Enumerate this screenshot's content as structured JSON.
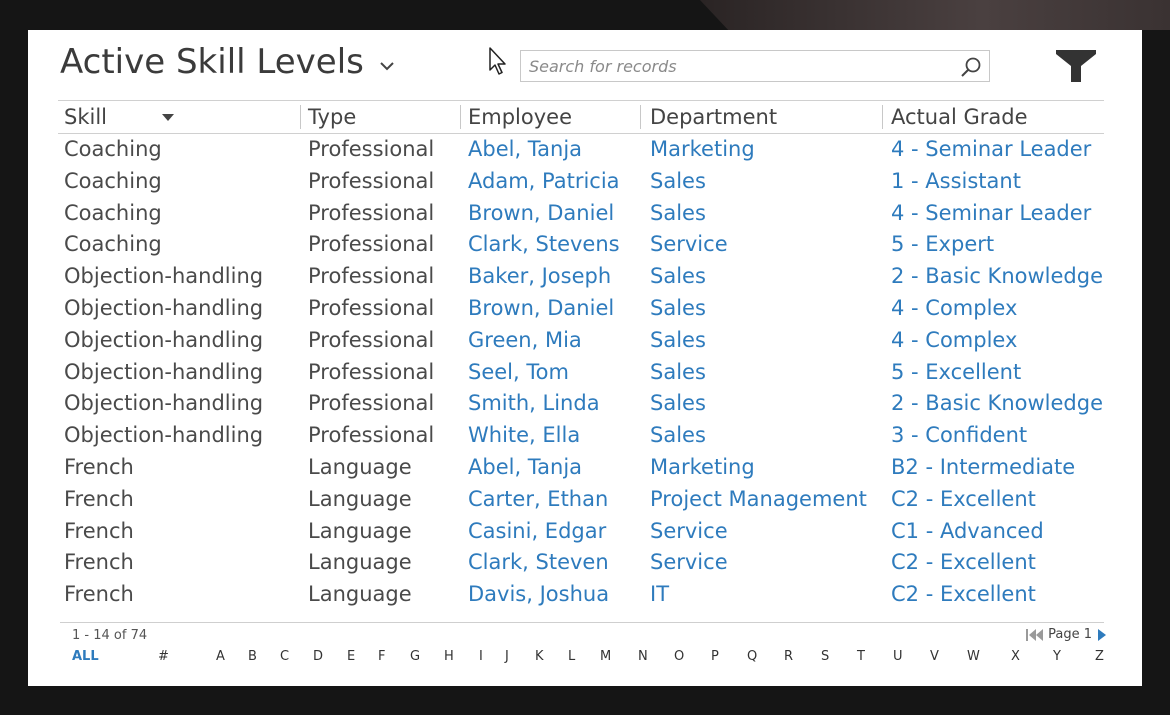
{
  "header": {
    "title": "Active Skill Levels",
    "search_placeholder": "Search for records"
  },
  "columns": [
    "Skill",
    "Type",
    "Employee",
    "Department",
    "Actual Grade"
  ],
  "rows": [
    [
      "Coaching",
      "Professional",
      "Abel, Tanja",
      "Marketing",
      "4 - Seminar Leader"
    ],
    [
      "Coaching",
      "Professional",
      "Adam, Patricia",
      "Sales",
      "1 - Assistant"
    ],
    [
      "Coaching",
      "Professional",
      "Brown, Daniel",
      "Sales",
      "4 - Seminar Leader"
    ],
    [
      "Coaching",
      "Professional",
      "Clark, Stevens",
      "Service",
      "5 - Expert"
    ],
    [
      "Objection-handling",
      "Professional",
      "Baker, Joseph",
      "Sales",
      "2 - Basic Knowledge"
    ],
    [
      "Objection-handling",
      "Professional",
      "Brown, Daniel",
      "Sales",
      "4 - Complex"
    ],
    [
      "Objection-handling",
      "Professional",
      "Green, Mia",
      "Sales",
      "4 - Complex"
    ],
    [
      "Objection-handling",
      "Professional",
      "Seel, Tom",
      "Sales",
      "5 - Excellent"
    ],
    [
      "Objection-handling",
      "Professional",
      "Smith, Linda",
      "Sales",
      "2 - Basic Knowledge"
    ],
    [
      "Objection-handling",
      "Professional",
      "White, Ella",
      "Sales",
      "3 - Confident"
    ],
    [
      "French",
      "Language",
      "Abel, Tanja",
      "Marketing",
      "B2 - Intermediate"
    ],
    [
      "French",
      "Language",
      "Carter, Ethan",
      "Project Management",
      "C2 - Excellent"
    ],
    [
      "French",
      "Language",
      "Casini, Edgar",
      "Service",
      "C1 - Advanced"
    ],
    [
      "French",
      "Language",
      "Clark, Steven",
      "Service",
      "C2 - Excellent"
    ],
    [
      "French",
      "Language",
      "Davis, Joshua",
      "IT",
      "C2 - Excellent"
    ]
  ],
  "footer": {
    "record_count": "1 - 14 of 74",
    "page_label": "Page 1"
  },
  "alphabet": [
    "ALL",
    "#",
    "A",
    "B",
    "C",
    "D",
    "E",
    "F",
    "G",
    "H",
    "I",
    "J",
    "K",
    "L",
    "M",
    "N",
    "O",
    "P",
    "Q",
    "R",
    "S",
    "T",
    "U",
    "V",
    "W",
    "X",
    "Y",
    "Z"
  ],
  "colors": {
    "link": "#2e7bbd",
    "text": "#4a4a4a",
    "title": "#3b3b3b"
  },
  "icons": {
    "title_dropdown": "chevron-down-icon",
    "search": "search-icon",
    "filter": "filter-icon",
    "sort": "sort-down-icon",
    "first_page": "first-page-icon",
    "next_page": "next-page-icon",
    "cursor": "mouse-cursor-icon"
  }
}
